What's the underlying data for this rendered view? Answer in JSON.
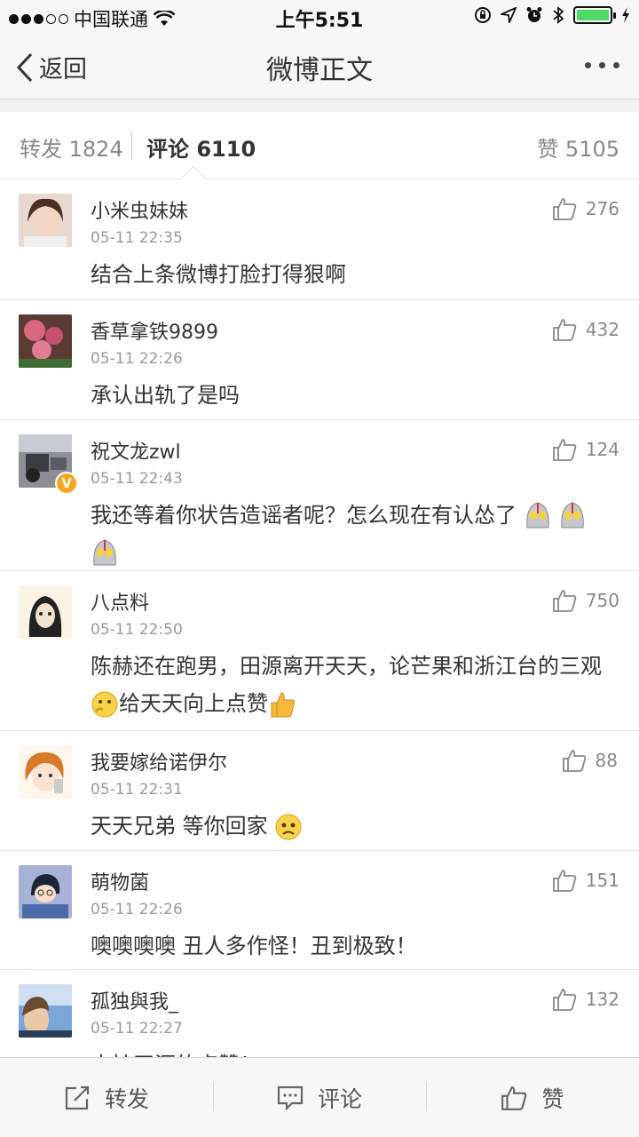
{
  "status_bar": {
    "carrier": "中国联通",
    "time": "上午5:51"
  },
  "nav": {
    "back_label": "返回",
    "title": "微博正文"
  },
  "tabs": {
    "repost_label": "转发",
    "repost_count": "1824",
    "comment_label": "评论",
    "comment_count": "6110",
    "like_label": "赞",
    "like_count": "5105"
  },
  "comments": [
    {
      "name": "小米虫妹妹",
      "time": "05-11 22:35",
      "text": "结合上条微博打脸打得狠啊",
      "likes": "276"
    },
    {
      "name": "香草拿铁9899",
      "time": "05-11 22:26",
      "text": "承认出轨了是吗",
      "likes": "432"
    },
    {
      "name": "祝文龙zwl",
      "time": "05-11 22:43",
      "text": "我还等着你状告造谣者呢？怎么现在有认怂了",
      "likes": "124",
      "verified": "V"
    },
    {
      "name": "八点料",
      "time": "05-11 22:50",
      "text_a": "陈赫还在跑男，田源离开天天，论芒果和浙江台的三观",
      "text_b": "给天天向上点赞",
      "likes": "750"
    },
    {
      "name": "我要嫁给诺伊尔",
      "time": "05-11 22:31",
      "text": "天天兄弟 等你回家",
      "likes": "88"
    },
    {
      "name": "萌物菌",
      "time": "05-11 22:26",
      "text": "噢噢噢噢 丑人多作怪！丑到极致！",
      "likes": "151"
    },
    {
      "name": "孤独與我_",
      "time": "05-11 22:27",
      "text": "支持田源的点赞！",
      "likes": "132"
    }
  ],
  "bottom_bar": {
    "repost": "转发",
    "comment": "评论",
    "like": "赞"
  },
  "colors": {
    "accent_badge": "#f6a623",
    "battery": "#4cd964",
    "background": "#f2f2f2"
  }
}
